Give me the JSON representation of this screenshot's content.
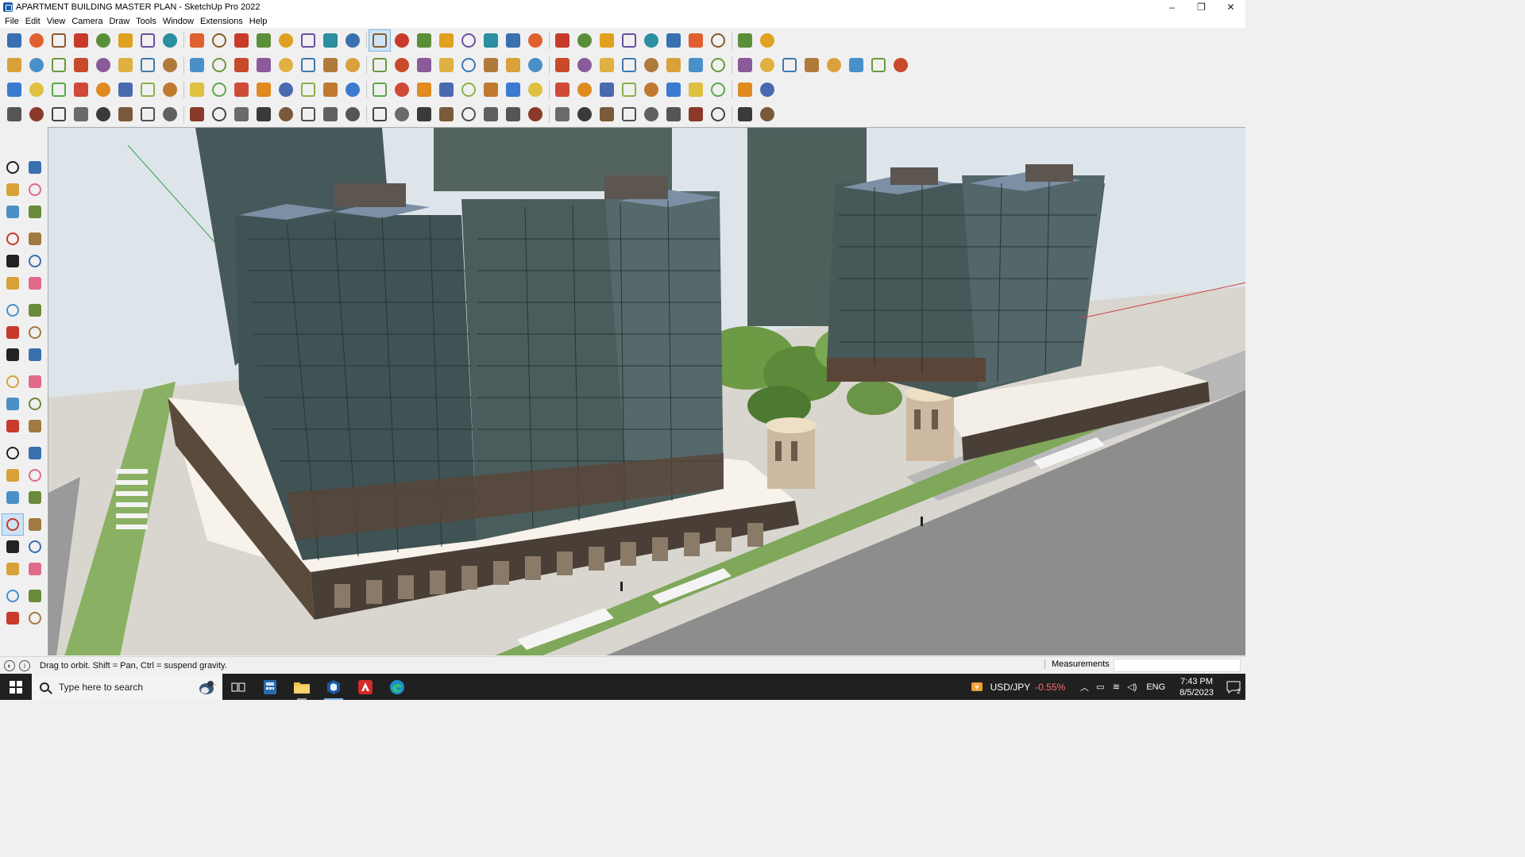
{
  "window": {
    "title": "APARTMENT BUILDING MASTER PLAN - SketchUp Pro 2022",
    "controls": [
      "–",
      "❐",
      "✕"
    ]
  },
  "menu": [
    "File",
    "Edit",
    "View",
    "Camera",
    "Draw",
    "Tools",
    "Window",
    "Extensions",
    "Help"
  ],
  "toolbar_rows": [
    {
      "count": 38,
      "colors": [
        "#3a6fb0",
        "#e06030",
        "#8a5a2a",
        "#c83a2a",
        "#5a8f3a",
        "#e0a020",
        "#6a4fa0",
        "#2a8fa0"
      ]
    },
    {
      "count": 44,
      "colors": [
        "#d9a13a",
        "#4a90c8",
        "#6a9a3a",
        "#c84a2a",
        "#8a5a9a",
        "#e0b040",
        "#3a7ab0",
        "#b07a3a"
      ]
    },
    {
      "count": 38,
      "colors": [
        "#3a7ad0",
        "#e0c040",
        "#5aa84a",
        "#d04a3a",
        "#e08a20",
        "#4a6ab0",
        "#8ab04a",
        "#c07a30"
      ]
    },
    {
      "count": 38,
      "colors": [
        "#555555",
        "#8a3a2a",
        "#444444",
        "#6a6a6a",
        "#3a3a3a",
        "#7a5a3a",
        "#505050",
        "#606060"
      ]
    }
  ],
  "left_tools": {
    "count": 40,
    "colors": [
      "#222222",
      "#3a6fb0",
      "#d9a13a",
      "#e06a8a",
      "#4a90c8",
      "#6a8a3a",
      "#c83a2a",
      "#a07a40"
    ]
  },
  "status": {
    "hint": "Drag to orbit. Shift = Pan, Ctrl = suspend gravity.",
    "measurements_label": "Measurements",
    "measurements_value": ""
  },
  "taskbar": {
    "search_placeholder": "Type here to search",
    "apps": [
      "task-view",
      "calculator",
      "file-explorer",
      "sketchup",
      "acrobat",
      "edge"
    ],
    "ticker_symbol": "USD/JPY",
    "ticker_change": "-0.55%",
    "language": "ENG",
    "time": "7:43 PM",
    "date": "8/5/2023",
    "notifications": "2"
  }
}
